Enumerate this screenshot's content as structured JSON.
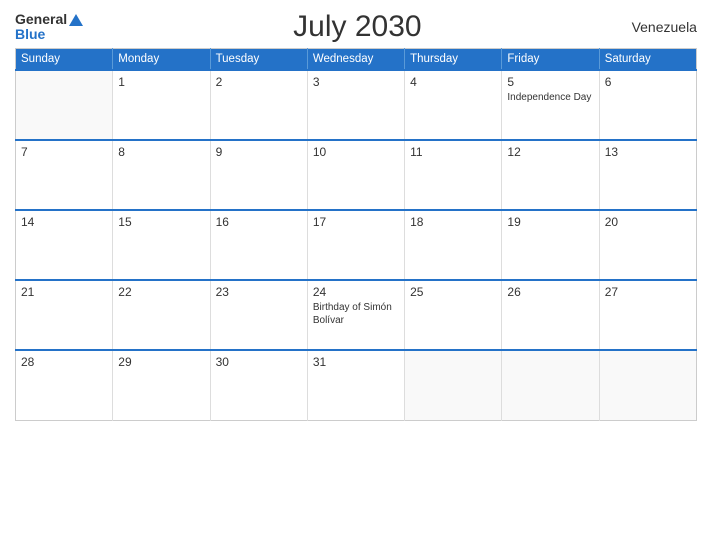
{
  "logo": {
    "general": "General",
    "blue": "Blue"
  },
  "title": "July 2030",
  "country": "Venezuela",
  "days_header": [
    "Sunday",
    "Monday",
    "Tuesday",
    "Wednesday",
    "Thursday",
    "Friday",
    "Saturday"
  ],
  "weeks": [
    [
      {
        "day": "",
        "empty": true
      },
      {
        "day": "1",
        "event": ""
      },
      {
        "day": "2",
        "event": ""
      },
      {
        "day": "3",
        "event": ""
      },
      {
        "day": "4",
        "event": ""
      },
      {
        "day": "5",
        "event": "Independence Day"
      },
      {
        "day": "6",
        "event": ""
      }
    ],
    [
      {
        "day": "7",
        "event": ""
      },
      {
        "day": "8",
        "event": ""
      },
      {
        "day": "9",
        "event": ""
      },
      {
        "day": "10",
        "event": ""
      },
      {
        "day": "11",
        "event": ""
      },
      {
        "day": "12",
        "event": ""
      },
      {
        "day": "13",
        "event": ""
      }
    ],
    [
      {
        "day": "14",
        "event": ""
      },
      {
        "day": "15",
        "event": ""
      },
      {
        "day": "16",
        "event": ""
      },
      {
        "day": "17",
        "event": ""
      },
      {
        "day": "18",
        "event": ""
      },
      {
        "day": "19",
        "event": ""
      },
      {
        "day": "20",
        "event": ""
      }
    ],
    [
      {
        "day": "21",
        "event": ""
      },
      {
        "day": "22",
        "event": ""
      },
      {
        "day": "23",
        "event": ""
      },
      {
        "day": "24",
        "event": "Birthday of Simón Bolívar"
      },
      {
        "day": "25",
        "event": ""
      },
      {
        "day": "26",
        "event": ""
      },
      {
        "day": "27",
        "event": ""
      }
    ],
    [
      {
        "day": "28",
        "event": ""
      },
      {
        "day": "29",
        "event": ""
      },
      {
        "day": "30",
        "event": ""
      },
      {
        "day": "31",
        "event": ""
      },
      {
        "day": "",
        "empty": true
      },
      {
        "day": "",
        "empty": true
      },
      {
        "day": "",
        "empty": true
      }
    ]
  ]
}
